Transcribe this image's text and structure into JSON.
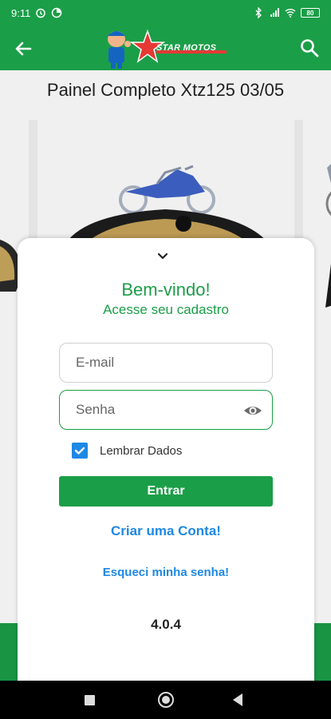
{
  "status_bar": {
    "time": "9:11",
    "battery": "80"
  },
  "header": {
    "logo_text": "STAR MOTOS"
  },
  "product": {
    "title": "Painel Completo Xtz125 03/05"
  },
  "login": {
    "welcome": "Bem-vindo!",
    "subtitle": "Acesse seu cadastro",
    "email_placeholder": "E-mail",
    "password_placeholder": "Senha",
    "remember_label": "Lembrar Dados",
    "remember_checked": true,
    "enter_label": "Entrar",
    "create_account_label": "Criar uma Conta!",
    "forgot_password_label": "Esqueci minha senha!",
    "version": "4.0.4"
  },
  "colors": {
    "primary_green": "#1b9e48",
    "link_blue": "#1e88e5"
  },
  "icons": [
    "back-arrow-icon",
    "search-icon",
    "chevron-down-icon",
    "eye-icon",
    "checkbox-checked-icon"
  ]
}
